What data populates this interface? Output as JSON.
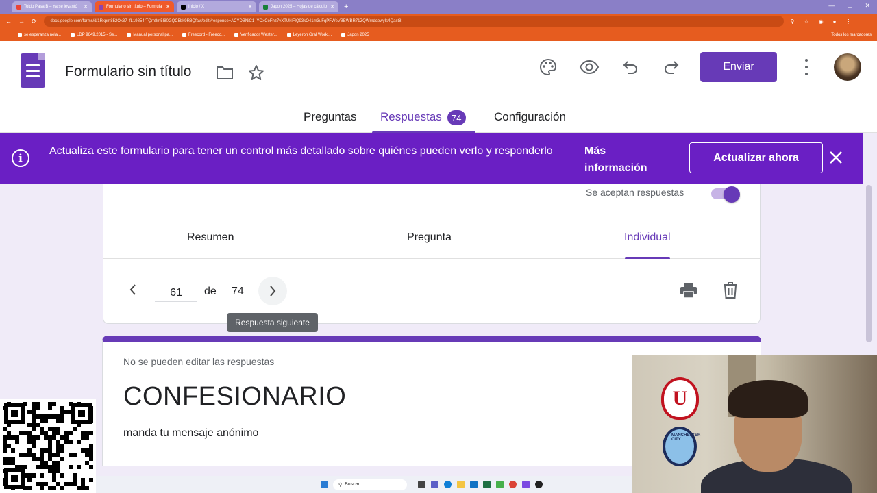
{
  "browser": {
    "tabs": [
      {
        "label": "Toldo Pasa B – Ya se levantó",
        "color": "#ea4335",
        "active": false
      },
      {
        "label": "Formulario sin título – Formula",
        "color": "#8e44ad",
        "active": true
      },
      {
        "label": "Inicio / X",
        "color": "#000000",
        "active": false
      },
      {
        "label": "Japon 2025 – Hojas de cálculo",
        "color": "#188038",
        "active": false
      }
    ],
    "new_tab": "+",
    "url": "docs.google.com/forms/d/1Rkpm852Ok37_fL19854rTQm8m5I80GQC5bk9R8Qfaw/edit#response=ACYDBNiC1_YOxCeFhz7yXTUkIFlQ93kO41m3uFqPFWeVBBWBR71ZQWmdcbwyIs4Qast8",
    "bookmarks": [
      "se esperanza nela...",
      "LDP 9649.2015 - Se...",
      "Manual personal pa...",
      "Freecord - Freeco...",
      "Verificador Wester...",
      "Leyeron Gral Worki...",
      "Japon 2025"
    ],
    "bookmarks_right": "Todos los marcadores"
  },
  "app": {
    "title": "Formulario sin título",
    "send_label": "Enviar",
    "nav": {
      "questions": "Preguntas",
      "responses": "Respuestas",
      "responses_count": "74",
      "settings": "Configuración"
    }
  },
  "banner": {
    "message": "Actualiza este formulario para tener un control más detallado sobre quiénes pueden verlo y responderlo",
    "more_info": "Más información",
    "update": "Actualizar ahora"
  },
  "responses": {
    "accepting_label": "Se aceptan respuestas",
    "accepting": true,
    "tabs": {
      "summary": "Resumen",
      "question": "Pregunta",
      "individual": "Individual"
    },
    "pager": {
      "current": "61",
      "of": "de",
      "total": "74"
    },
    "tooltip": "Respuesta siguiente"
  },
  "form": {
    "notice": "No se pueden editar las respuestas",
    "title": "CONFESIONARIO",
    "description": "manda tu mensaje anónimo"
  },
  "taskbar": {
    "search_placeholder": "Buscar"
  },
  "webcam": {
    "crest_letter": "U",
    "crest2_text": "MANCHESTER CITY"
  },
  "colors": {
    "accent": "#673ab7",
    "banner": "#6a1fc4",
    "browser_chrome": "#e65c1f"
  }
}
